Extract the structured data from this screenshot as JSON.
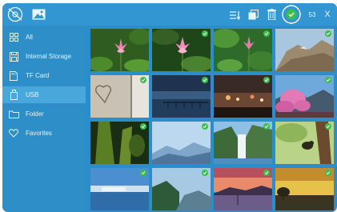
{
  "toolbar": {
    "back_icon": "gallery-off-icon",
    "image_icon": "image-icon",
    "sort_icon": "sort-list-icon",
    "copy_icon": "copy-icon",
    "delete_icon": "trash-icon",
    "select_all_icon": "check-circle-icon",
    "selected_count": "53",
    "close_label": "X"
  },
  "sidebar": {
    "items": [
      {
        "label": "All",
        "icon": "grid-icon",
        "selected": false
      },
      {
        "label": "Internal Storage",
        "icon": "storage-icon",
        "selected": false
      },
      {
        "label": "TF Card",
        "icon": "sd-card-icon",
        "selected": false
      },
      {
        "label": "USB",
        "icon": "usb-icon",
        "selected": true
      },
      {
        "label": "Folder",
        "icon": "folder-icon",
        "selected": false
      },
      {
        "label": "Favorites",
        "icon": "heart-icon",
        "selected": false
      }
    ]
  },
  "grid": {
    "thumbnails": [
      {
        "subject": "lotus-flower",
        "checked": false
      },
      {
        "subject": "lotus-flower",
        "checked": true
      },
      {
        "subject": "lotus-flower",
        "checked": true
      },
      {
        "subject": "rocky-mountain",
        "checked": true
      },
      {
        "subject": "heart-in-sand",
        "checked": true
      },
      {
        "subject": "pier-at-dusk",
        "checked": true
      },
      {
        "subject": "city-lights-bokeh",
        "checked": true
      },
      {
        "subject": "pink-blossom-tree",
        "checked": true
      },
      {
        "subject": "mossy-tree",
        "checked": true
      },
      {
        "subject": "misty-mountains",
        "checked": true
      },
      {
        "subject": "waterfall",
        "checked": true
      },
      {
        "subject": "bird-on-branch",
        "checked": true
      },
      {
        "subject": "lake-town",
        "checked": true
      },
      {
        "subject": "mountain-valley",
        "checked": true
      },
      {
        "subject": "sunset-lake",
        "checked": true
      },
      {
        "subject": "yellow-sunset-tree",
        "checked": true
      }
    ]
  },
  "colors": {
    "app_background": "#2b8ecb",
    "topbar": "#3196d1",
    "sidebar_selected": "#4aa7dc",
    "check_green": "#3bbf4a"
  }
}
